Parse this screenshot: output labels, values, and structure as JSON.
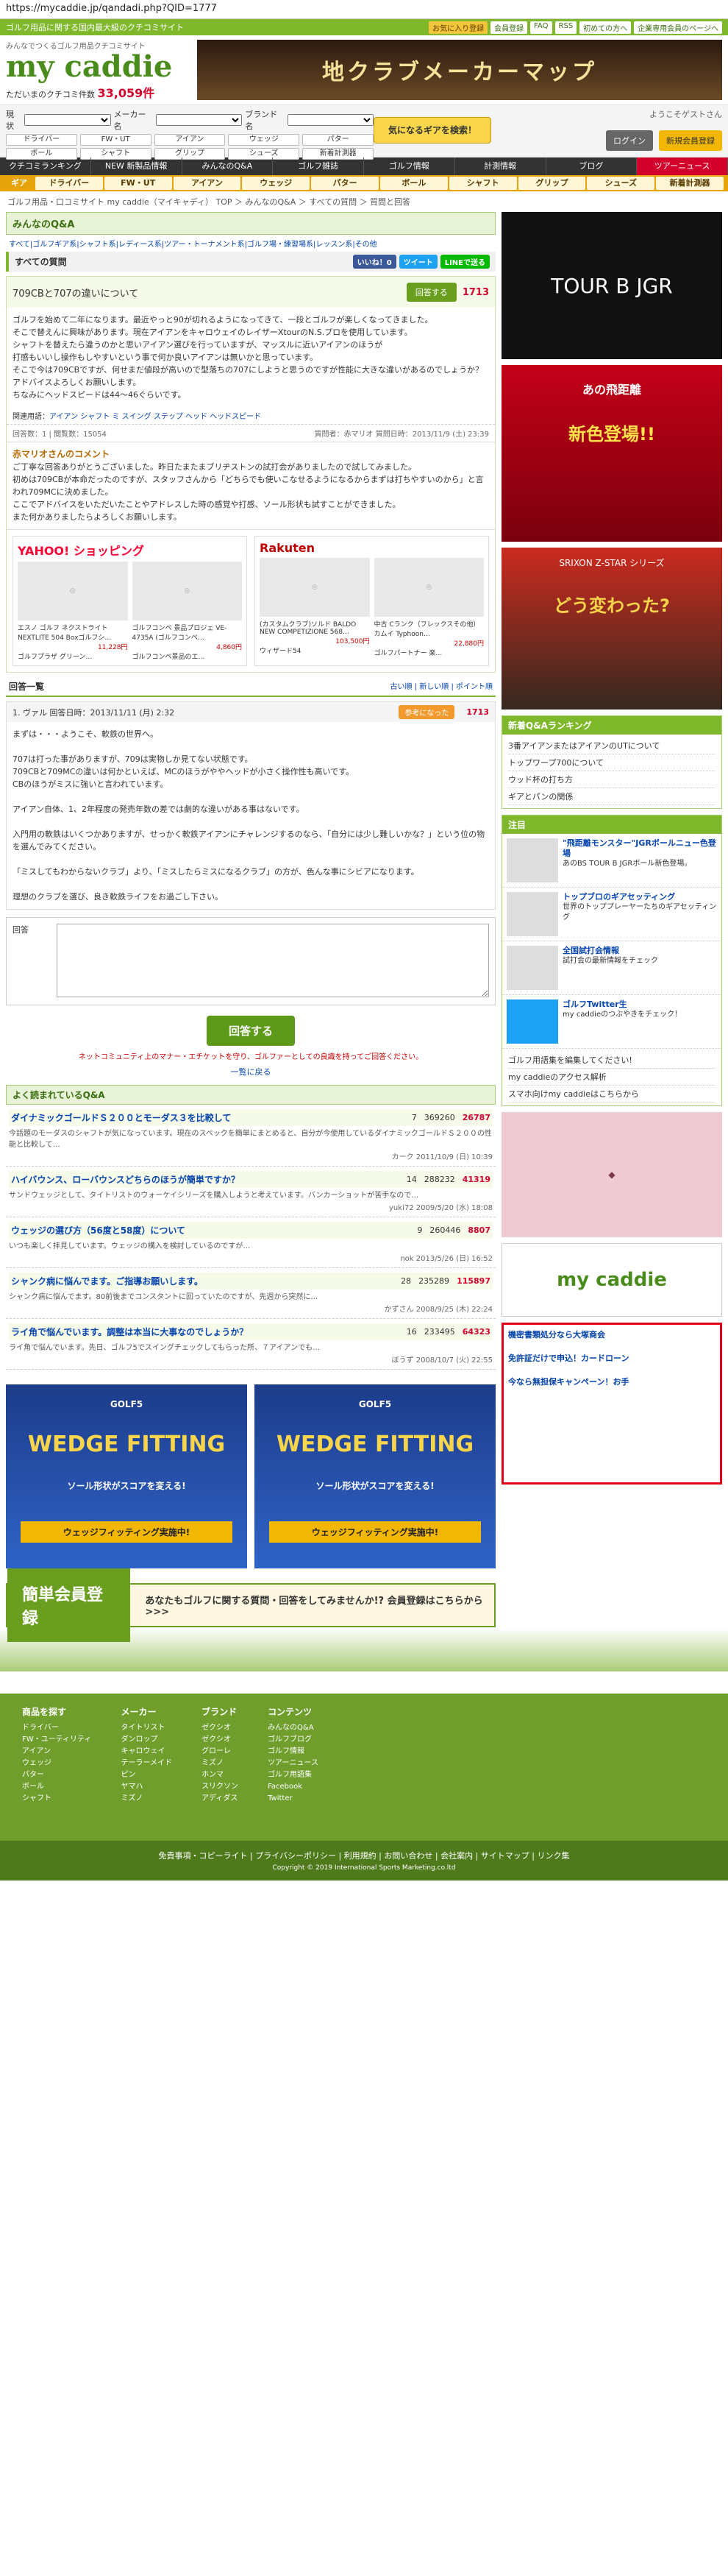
{
  "url": "https://mycaddie.jp/qandadi.php?QID=1777",
  "topstrip": {
    "text": "ゴルフ用品に関する国内最大級のクチコミサイト",
    "links": [
      "お気に入り登録",
      "会員登録",
      "FAQ",
      "RSS",
      "初めての方へ",
      "企業専用会員のページへ"
    ]
  },
  "logo": {
    "tag": "みんなでつくるゴルフ用品クチコミサイト",
    "name": "my caddie",
    "count_label": "ただいまのクチコミ件数",
    "count": "33,059件"
  },
  "banner_top": "地クラブメーカーマップ",
  "search": {
    "l1": "現状",
    "l2": "メーカー名",
    "l3": "ブランド名",
    "cats": [
      "ドライバー",
      "FW・UT",
      "アイアン",
      "ウェッジ",
      "パター",
      "ボール",
      "シャフト",
      "グリップ",
      "シューズ",
      "新着計測器"
    ],
    "btn": "気になるギアを検索！"
  },
  "login": {
    "greet": "ようこそゲストさん",
    "login": "ログイン",
    "register": "新規会員登録"
  },
  "nav1": [
    "クチコミランキング",
    "NEW 新製品情報",
    "みんなのQ&A",
    "ゴルフ雑誌",
    "ゴルフ情報",
    "計測情報",
    "ブログ",
    "ツアーニュース"
  ],
  "nav2": [
    "ギア",
    "ドライバー",
    "FW・UT",
    "アイアン",
    "ウェッジ",
    "パター",
    "ボール",
    "シャフト",
    "グリップ",
    "シューズ",
    "新着計測器"
  ],
  "crumb": "ゴルフ用品・口コミサイト my caddie（マイキャディ） TOP ＞ みんなのQ&A ＞ すべての質問 ＞ 質問と回答",
  "section_title": "みんなのQ&A",
  "cattags": "すべて|ゴルフギア系|シャフト系|レディース系|ツアー・トーナメント系|ゴルフ場・練習場系|レッスン系|その他",
  "allq": {
    "title": "すべての質問",
    "like": "いいね！0",
    "tweet": "ツイート",
    "line": "LINEで送る"
  },
  "question": {
    "title": "709CBと707の違いについて",
    "btn": "回答する",
    "pt": "1713",
    "body": "ゴルフを始めて二年になります。最近やっと90が切れるようになってきて、一段とゴルフが楽しくなってきました。\nそこで替えんに興味があります。現在アイアンをキャロウェイのレイザーXtourのN.S.プロを使用しています。\nシャフトを替えたら違うのかと思いアイアン選びを行っていますが、マッスルに近いアイアンのほうが\n打感もいいし操作もしやすいという事で何か良いアイアンは無いかと思っています。\nそこで今は709CBですが、何せまだ値段が高いので型落ちの707にしようと思うのですが性能に大きな違いがあるのでしょうか？\nアドバイスよろしくお願いします。\nちなみにヘッドスピードは44～46ぐらいです。",
    "tags_label": "関連用語：",
    "tags": "アイアン シャフト ミ スイング ステップ ヘッド ヘッドスピード",
    "meta_left": "回答数：1 | 閲覧数：15054",
    "meta_right": "質問者：赤マリオ 質問日時：2013/11/9 (土) 23:39"
  },
  "best": {
    "title": "赤マリオさんのコメント",
    "body": "ご丁寧な回答ありがとうございました。昨日たまたまブリヂストンの試打会がありましたので試してみました。\n初めは709CBが本命だったのですが、スタッフさんから「どちらでも使いこなせるようになるからまずは打ちやすいのから」と言われ709MCに決めました。\nここでアドバイスをいただいたことやアドレスした時の感覚や打感、ソール形状も試すことができました。\nまた何かありましたらよろしくお願いします。"
  },
  "shops": [
    {
      "name": "YAHOO! ショッピング",
      "items": [
        {
          "t": "エスノ ゴルフ ネクストライト NEXTLITE 504 Boxゴルフシ…",
          "p": "11,228円",
          "s": "ゴルフプラザ グリーン…"
        },
        {
          "t": "ゴルフコンペ 景品プロジェ VE-4735A (ゴルフコンペ…",
          "p": "4,860円",
          "s": "ゴルフコンペ景品のエ…"
        }
      ]
    },
    {
      "name": "Rakuten",
      "items": [
        {
          "t": "(カスタムクラブ)ソルド BALDO NEW COMPETIZIONE 568…",
          "p": "103,500円",
          "s": "ウィザード54"
        },
        {
          "t": "中古 Cランク（フレックスその他）カムイ Typhoon…",
          "p": "22,880円",
          "s": "ゴルフパートナー 楽…"
        }
      ]
    }
  ],
  "answers_head": {
    "title": "回答一覧",
    "sort": "古い順 | 新しい順 | ポイント順"
  },
  "answer": {
    "no": "1. ヴァル 回答日時：2013/11/11 (月) 2:32",
    "good": "参考になった",
    "pt": "1713",
    "body": "まずは・・・ようこそ、軟鉄の世界へ。\n\n707は打った事がありますが、709は実物しか見てない状態です。\n709CBと709MCの違いは何かといえば、MCのほうがややヘッドが小さく操作性も高いです。\nCBのほうがミスに強いと言われています。\n\nアイアン自体、1、2年程度の発売年数の差では劇的な違いがある事はないです。\n\n入門用の軟鉄はいくつかありますが、せっかく軟鉄アイアンにチャレンジするのなら、「自分には少し難しいかな？」という位の物を選んでみてください。\n\n「ミスしてもわからないクラブ」より、「ミスしたらミスになるクラブ」の方が、色んな事にシビアになります。\n\n理想のクラブを選び、良き軟鉄ライフをお過ごし下さい。"
  },
  "form": {
    "label": "回答",
    "submit": "回答する",
    "note": "ネットコミュニティ上のマナー・エチケットを守り、ゴルファーとしての良識を持ってご回答ください。",
    "back": "一覧に戻る"
  },
  "popular": {
    "title": "よく読まれているQ&A",
    "items": [
      {
        "t": "ダイナミックゴールドＳ２００とモーダス３を比較して",
        "a": "7",
        "v": "369260",
        "p": "26787",
        "b": "今話題のモーダスのシャフトが気になっています。現在のスペックを簡単にまとめると、自分が今使用しているダイナミックゴールドＳ２００の性能と比較して…",
        "m": "カーク 2011/10/9 (日) 10:39"
      },
      {
        "t": "ハイバウンス、ローバウンスどちらのほうが簡単ですか？",
        "a": "14",
        "v": "288232",
        "p": "41319",
        "b": "サンドウェッジとして、タイトリストのウォーケイシリーズを購入しようと考えています。バンカーショットが苦手なので…",
        "m": "yuki72 2009/5/20 (水) 18:08"
      },
      {
        "t": "ウェッジの選び方（56度と58度）について",
        "a": "9",
        "v": "260446",
        "p": "8807",
        "b": "いつも楽しく拝見しています。ウェッジの構入を検討しているのですが…",
        "m": "nok 2013/5/26 (日) 16:52"
      },
      {
        "t": "シャンク病に悩んでます。ご指導お願いします。",
        "a": "28",
        "v": "235289",
        "p": "115897",
        "b": "シャンク病に悩んでます。80前後までコンスタントに回っていたのですが、先週から突然に…",
        "m": "かずさん 2008/9/25 (木) 22:24"
      },
      {
        "t": "ライ角で悩んでいます。調整は本当に大事なのでしょうか？",
        "a": "16",
        "v": "233495",
        "p": "64323",
        "b": "ライ角で悩んでいます。先日、ゴルフ5でスイングチェックしてもらった所、７アイアンでも…",
        "m": "ぼうず 2008/10/7 (火) 22:55"
      }
    ]
  },
  "ads": {
    "golf5": "GOLF5",
    "wedge": "WEDGE FITTING",
    "wedge_sub": "ソール形状がスコアを変える!",
    "wedge_btn": "ウェッジフィッティング実施中!"
  },
  "reg": {
    "l": "簡単会員登録",
    "r": "あなたもゴルフに関する質問・回答をしてみませんか!? 会員登録はこちらから>>>"
  },
  "side": {
    "ad1": "TOUR B JGR",
    "ad2_t": "あの飛距離",
    "ad2_b": "新色登場!!",
    "ad3_t": "SRIXON Z-STAR シリーズ",
    "ad3_b": "どう変わった?",
    "box1": {
      "h": "新着Q&Aランキング",
      "items": [
        "3番アイアンまたはアイアンのUTについて",
        "トップワープ700について",
        "ウッド杯の打ち方",
        "ギアとパンの関係"
      ]
    },
    "box2": {
      "h": "注目",
      "items": [
        {
          "b": "\"飛距離モンスター\"JGRボールニュー色登場",
          "t": "あのBS TOUR B JGRボール新色登場。"
        },
        {
          "b": "トップブロのギアセッティング",
          "t": "世界のトッププレーヤーたちのギアセッティング"
        },
        {
          "b": "全国試打会情報",
          "t": "試打会の最新情報をチェック"
        },
        {
          "b": "ゴルフTwitter生",
          "t": "my caddieのつぶやきをチェック！"
        }
      ]
    },
    "links": [
      "ゴルフ用語集を編集してください!",
      "my caddieのアクセス解析",
      "スマホ向けmy caddieはこちらから"
    ],
    "ad5": "my caddie",
    "ad6": {
      "t1": "機密書類処分なら大塚商会",
      "t2": "免許証だけで申込！カードローン",
      "t3": "今なら無担保キャンペーン！お手"
    }
  },
  "footer": {
    "cols": [
      {
        "h": "商品を探す",
        "items": [
          "ドライバー",
          "FW・ユーティリティ",
          "アイアン",
          "ウェッジ",
          "パター",
          "ボール",
          "シャフト"
        ]
      },
      {
        "h": "メーカー",
        "items": [
          "タイトリスト",
          "ダンロップ",
          "キャロウェイ",
          "テーラーメイド",
          "ピン",
          "ヤマハ",
          "ミズノ"
        ]
      },
      {
        "h": "ブランド",
        "items": [
          "ゼクシオ",
          "ゼクシオ",
          "グローレ",
          "ミズノ",
          "ホンマ",
          "スリクソン",
          "アディダス"
        ]
      },
      {
        "h": "コンテンツ",
        "items": [
          "みんなのQ&A",
          "ゴルフブログ",
          "ゴルフ情報",
          "ツアーニュース",
          "ゴルフ用語集",
          "Facebook",
          "Twitter"
        ]
      }
    ],
    "bottom": "免責事項・コピーライト | プライバシーポリシー | 利用規約 | お問い合わせ | 会社案内 | サイトマップ | リンク集",
    "copy": "Copyright © 2019 International Sports Marketing.co.ltd"
  }
}
